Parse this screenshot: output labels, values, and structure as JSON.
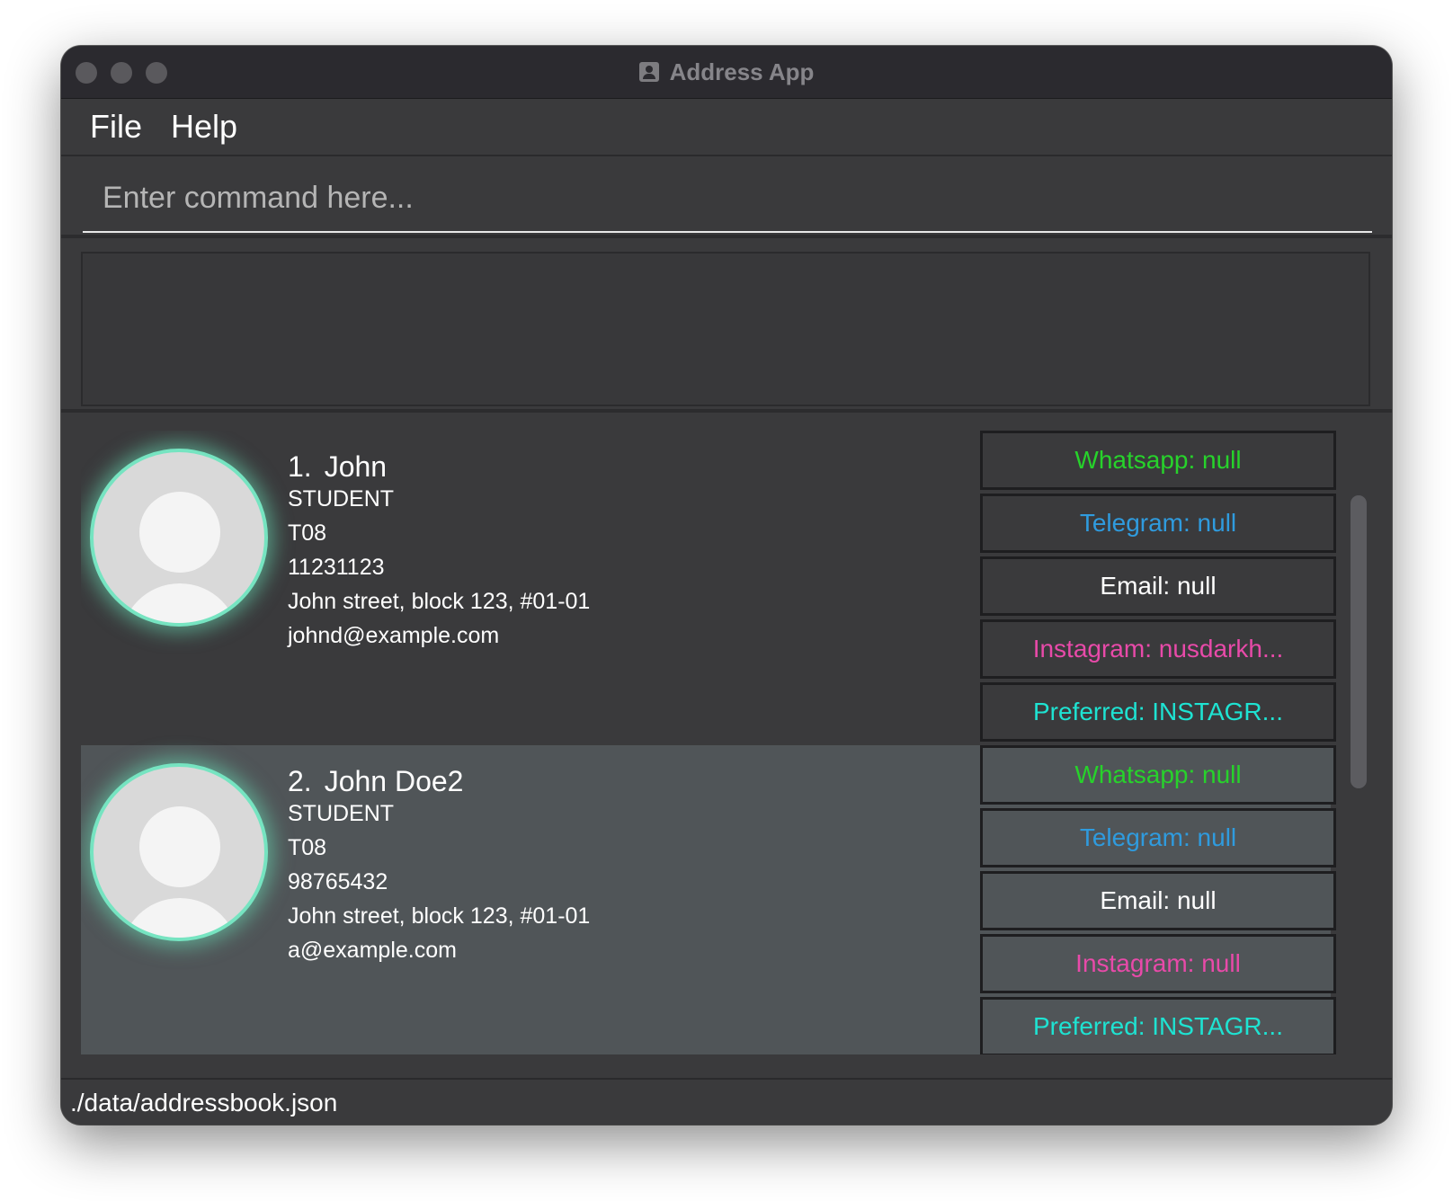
{
  "window": {
    "title": "Address App",
    "title_icon": "contact-book-icon"
  },
  "menu": {
    "file": "File",
    "help": "Help"
  },
  "command": {
    "placeholder": "Enter command here...",
    "value": ""
  },
  "result": {
    "text": ""
  },
  "persons": [
    {
      "index": "1.",
      "name": "John",
      "role": "STUDENT",
      "tutorial": "T08",
      "phone": "11231123",
      "address": "John street, block 123, #01-01",
      "email": "johnd@example.com",
      "card_bg": "#3a3a3c",
      "tags": [
        {
          "label": "Whatsapp: null",
          "color": "#27d22b"
        },
        {
          "label": "Telegram: null",
          "color": "#2f9bde"
        },
        {
          "label": "Email: null",
          "color": "#ffffff"
        },
        {
          "label": "Instagram: nusdarkh...",
          "color": "#e84aa9"
        },
        {
          "label": "Preferred: INSTAGR...",
          "color": "#1ee3d2"
        }
      ]
    },
    {
      "index": "2.",
      "name": "John Doe2",
      "role": "STUDENT",
      "tutorial": "T08",
      "phone": "98765432",
      "address": "John street, block 123, #01-01",
      "email": "a@example.com",
      "card_bg": "#505558",
      "tags": [
        {
          "label": "Whatsapp: null",
          "color": "#27d22b"
        },
        {
          "label": "Telegram: null",
          "color": "#2f9bde"
        },
        {
          "label": "Email: null",
          "color": "#ffffff"
        },
        {
          "label": "Instagram: null",
          "color": "#e84aa9"
        },
        {
          "label": "Preferred: INSTAGR...",
          "color": "#1ee3d2"
        }
      ]
    }
  ],
  "status_bar": {
    "path": "./data/addressbook.json"
  }
}
